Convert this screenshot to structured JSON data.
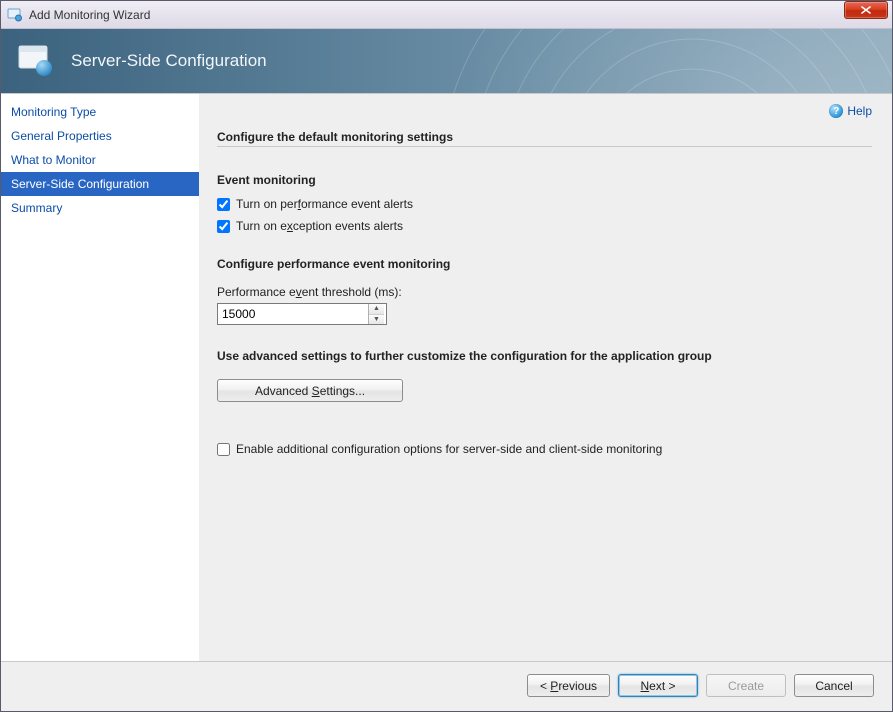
{
  "window": {
    "title": "Add Monitoring Wizard"
  },
  "banner": {
    "title": "Server-Side Configuration"
  },
  "sidebar": {
    "items": [
      {
        "label": "Monitoring Type",
        "active": false
      },
      {
        "label": "General Properties",
        "active": false
      },
      {
        "label": "What to Monitor",
        "active": false
      },
      {
        "label": "Server-Side Configuration",
        "active": true
      },
      {
        "label": "Summary",
        "active": false
      }
    ]
  },
  "help": {
    "label": "Help"
  },
  "main": {
    "configure_title": "Configure the default monitoring settings",
    "event_monitoring_header": "Event monitoring",
    "perf_alert_label_pre": "Turn on per",
    "perf_alert_label_u": "f",
    "perf_alert_label_post": "ormance event alerts",
    "perf_alert_checked": true,
    "exc_alert_label_pre": "Turn on e",
    "exc_alert_label_u": "x",
    "exc_alert_label_post": "ception events alerts",
    "exc_alert_checked": true,
    "perf_config_header": "Configure performance event monitoring",
    "threshold_label_pre": "Performance e",
    "threshold_label_u": "v",
    "threshold_label_post": "ent threshold (ms):",
    "threshold_value": "15000",
    "advanced_header": "Use advanced settings to further customize the configuration for the application group",
    "advanced_btn_pre": "Advanced ",
    "advanced_btn_u": "S",
    "advanced_btn_post": "ettings...",
    "enable_additional_label": "Enable additional configuration options for server-side and client-side monitoring",
    "enable_additional_checked": false
  },
  "footer": {
    "previous_pre": "< ",
    "previous_u": "P",
    "previous_post": "revious",
    "next_pre": "",
    "next_u": "N",
    "next_post": "ext >",
    "create": "Create",
    "cancel": "Cancel"
  }
}
